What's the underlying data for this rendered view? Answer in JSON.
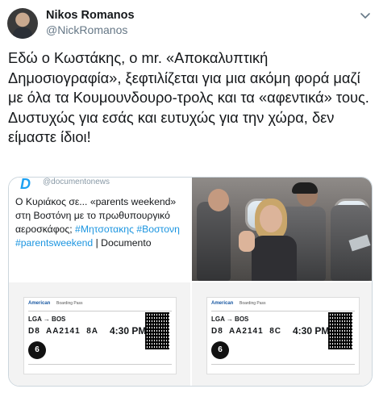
{
  "tweet": {
    "display_name": "Nikos Romanos",
    "handle": "@NickRomanos",
    "text": "Εδώ ο Κωστάκης, ο mr. «Αποκαλυπτική Δημοσιογραφία», ξεφτιλίζεται για μια ακόμη φορά μαζί με όλα τα Κουμουνδουρο-τρολς και τα «αφεντικά» τους.\nΔυστυχώς για εσάς και ευτυχώς για την χώρα, δεν είμαστε ίδιοι!"
  },
  "media": {
    "quoted": {
      "handle": "@documentonews",
      "text_plain": "Ο Κυριάκος σε... «parents weekend» στη Βοστόνη με το πρωθυπουργικό αεροσκάφος;",
      "hashtags": "#Μητσοτακης #Βοστονη #parentsweekend",
      "suffix": " | Documento"
    },
    "pass_left": {
      "airline": "American",
      "label": "Boarding Pass",
      "route": "LGA → BOS",
      "gate": "D8",
      "flight": "AA2141",
      "seat": "8A",
      "time": "4:30 PM",
      "group": "6"
    },
    "pass_right": {
      "airline": "American",
      "label": "Boarding Pass",
      "route": "LGA → BOS",
      "gate": "D8",
      "flight": "AA2141",
      "seat": "8C",
      "time": "4:30 PM",
      "group": "6"
    }
  },
  "icons": {
    "more": "chevron-down-icon"
  },
  "colors": {
    "link": "#1b95e0",
    "secondary_text": "#657786",
    "border": "#ccd6dd"
  }
}
